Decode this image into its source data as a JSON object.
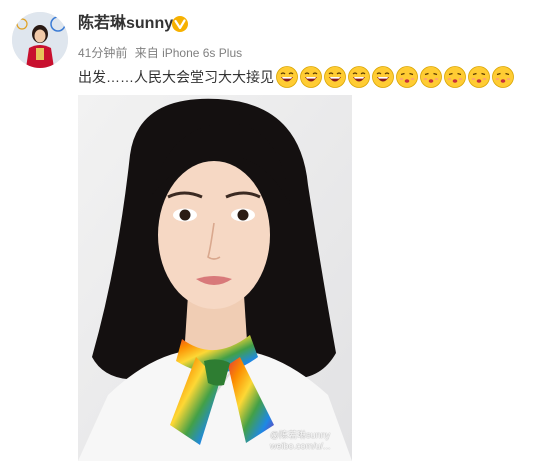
{
  "post": {
    "author_name": "陈若琳sunny",
    "time": "41分钟前",
    "source_prefix": "来自",
    "source_device": "iPhone 6s Plus",
    "text": "出发……人民大会堂习大大接见",
    "emojis": [
      "laughing-emoji",
      "laughing-emoji",
      "laughing-emoji",
      "laughing-emoji",
      "laughing-emoji",
      "kiss-emoji",
      "kiss-emoji",
      "kiss-emoji",
      "kiss-emoji",
      "kiss-emoji"
    ],
    "watermark": "@陈若琳sunny\nweibo.com/u/..."
  },
  "colors": {
    "verified_badge": "#f7b100",
    "emoji_yellow": "#ffcc33",
    "meta_gray": "#808080"
  }
}
